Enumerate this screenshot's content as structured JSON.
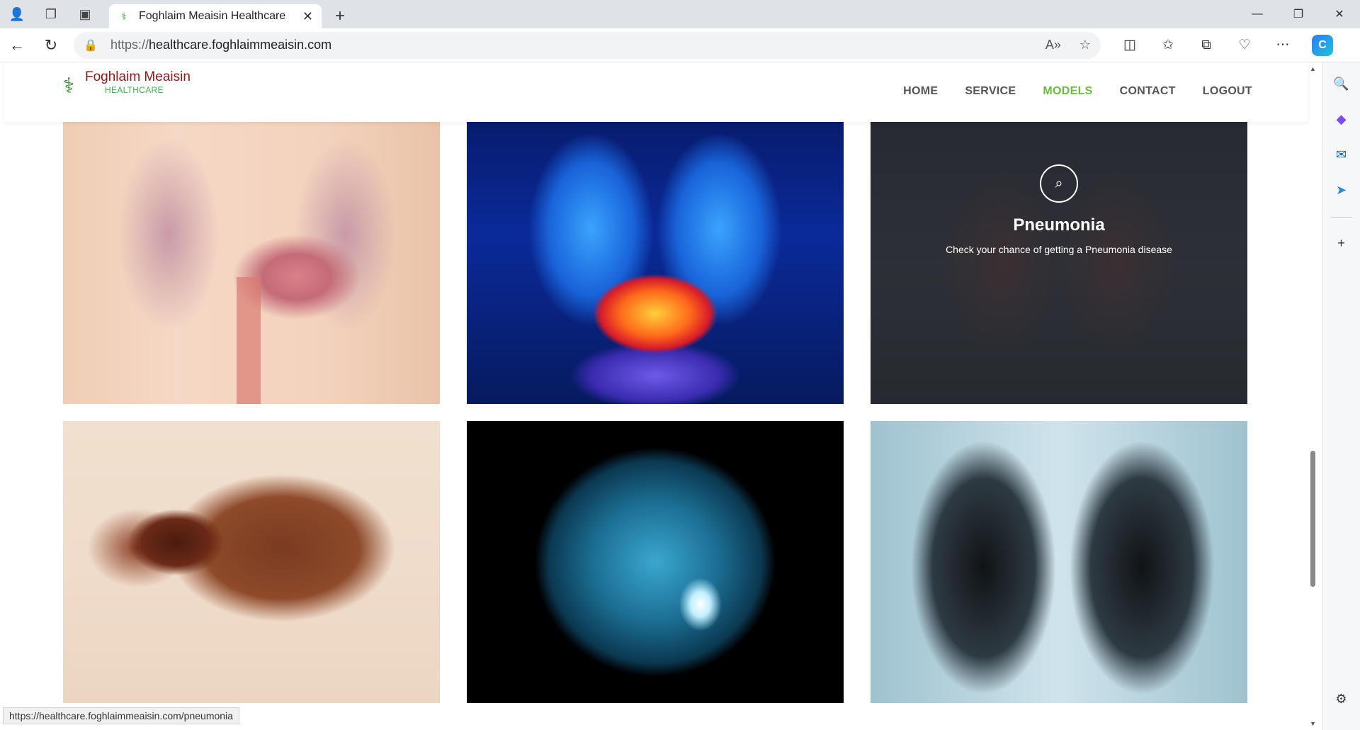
{
  "browser": {
    "tab_title": "Foghlaim Meaisin Healthcare",
    "url_scheme": "https://",
    "url_host": "healthcare.foghlaimmeaisin.com",
    "status_url": "https://healthcare.foghlaimmeaisin.com/pneumonia"
  },
  "site": {
    "logo_title": "Foghlaim Meaisin",
    "logo_subtitle": "HEALTHCARE",
    "nav": [
      {
        "label": "HOME",
        "active": false
      },
      {
        "label": "SERVICE",
        "active": false
      },
      {
        "label": "MODELS",
        "active": true
      },
      {
        "label": "CONTACT",
        "active": false
      },
      {
        "label": "LOGOUT",
        "active": false
      }
    ],
    "active_color": "#6abf3a"
  },
  "models": {
    "hover_card": {
      "title": "Pneumonia",
      "description": "Check your chance of getting a Pneumonia disease"
    },
    "cards": [
      {
        "image": "abdomen-organs"
      },
      {
        "image": "liver-xray"
      },
      {
        "image": "chest-lungs"
      },
      {
        "image": "skin-lesion"
      },
      {
        "image": "brain-scan"
      },
      {
        "image": "chest-xray"
      }
    ]
  }
}
